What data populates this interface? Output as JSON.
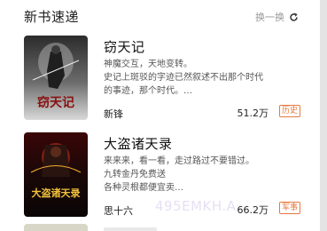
{
  "section": {
    "title": "新书速递",
    "switch_label": "换一换",
    "switch_icon": "refresh-icon"
  },
  "books": [
    {
      "title": "窃天记",
      "desc_lines": [
        "神魔交互，天地变转。",
        "史记上斑驳的字迹已然叙述不出那个时代",
        "的事迹，那个时代。…"
      ],
      "author": "新锋",
      "count": "51.2万",
      "tag": "历史",
      "cover_text": "窃天记"
    },
    {
      "title": "大盗诸天录",
      "desc_lines": [
        "来来来，看一看，走过路过不要错过。",
        "九转金丹免费送",
        "各种灵根都便宜卖…"
      ],
      "author": "思十六",
      "count": "66.2万",
      "tag": "军事",
      "cover_text": "大盗诸天录"
    }
  ],
  "watermark": "495EMKH.A",
  "colors": {
    "tag": "#e6793f",
    "muted": "#999999"
  }
}
